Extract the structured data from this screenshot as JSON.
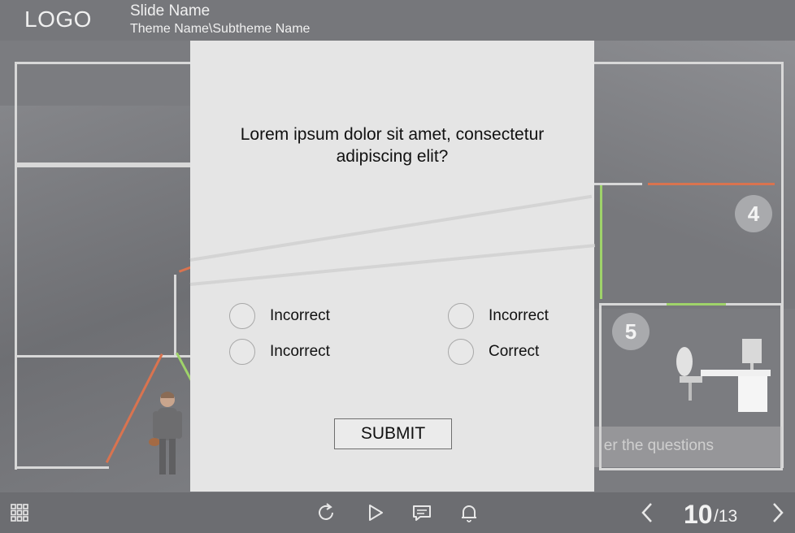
{
  "header": {
    "logo": "LOGO",
    "slide_name": "Slide Name",
    "theme_name": "Theme Name\\Subtheme Name"
  },
  "background": {
    "badges": [
      "4",
      "5"
    ],
    "answer_hint": "er the questions",
    "colors": {
      "wall": "#d8d8d8",
      "path_orange": "#d9734f",
      "path_green": "#9fd36a"
    }
  },
  "quiz": {
    "question": "Lorem ipsum dolor sit amet, consectetur adipiscing elit?",
    "options": [
      "Incorrect",
      "Incorrect",
      "Incorrect",
      "Correct"
    ],
    "submit_label": "SUBMIT"
  },
  "footer": {
    "icons": [
      "grid-menu-icon",
      "replay-icon",
      "play-icon",
      "chat-icon",
      "bell-icon",
      "prev-arrow-icon",
      "next-arrow-icon"
    ],
    "page_current": "10",
    "page_total": "/13"
  }
}
